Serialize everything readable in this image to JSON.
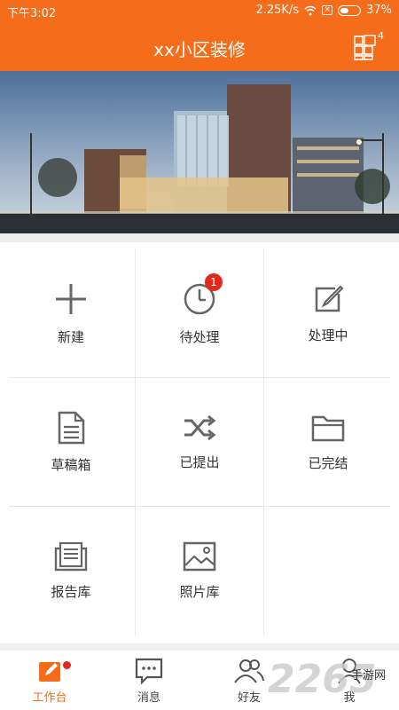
{
  "status_bar": {
    "time": "下午3:02",
    "net_speed": "2.25K/s",
    "battery": "37%"
  },
  "header": {
    "title": "xx小区装修",
    "grid_badge": "4",
    "grid_icon": "grid-icon"
  },
  "banner": {
    "alt": "building-photo"
  },
  "grid": [
    {
      "label": "新建",
      "icon": "plus-icon"
    },
    {
      "label": "待处理",
      "icon": "clock-icon",
      "badge": "1"
    },
    {
      "label": "处理中",
      "icon": "edit-icon"
    },
    {
      "label": "草稿箱",
      "icon": "document-icon"
    },
    {
      "label": "已提出",
      "icon": "shuffle-icon"
    },
    {
      "label": "已完结",
      "icon": "folder-icon"
    },
    {
      "label": "报告库",
      "icon": "report-icon"
    },
    {
      "label": "照片库",
      "icon": "image-icon"
    }
  ],
  "bottom_nav": [
    {
      "label": "工作台",
      "icon": "workbench-icon",
      "active": true
    },
    {
      "label": "消息",
      "icon": "message-icon"
    },
    {
      "label": "好友",
      "icon": "friends-icon"
    },
    {
      "label": "我",
      "icon": "me-icon"
    }
  ],
  "watermark": {
    "number": "2265",
    "text": "手游网"
  },
  "colors": {
    "accent": "#f56c1a",
    "badge": "#e02a1d",
    "icon": "#666666"
  }
}
